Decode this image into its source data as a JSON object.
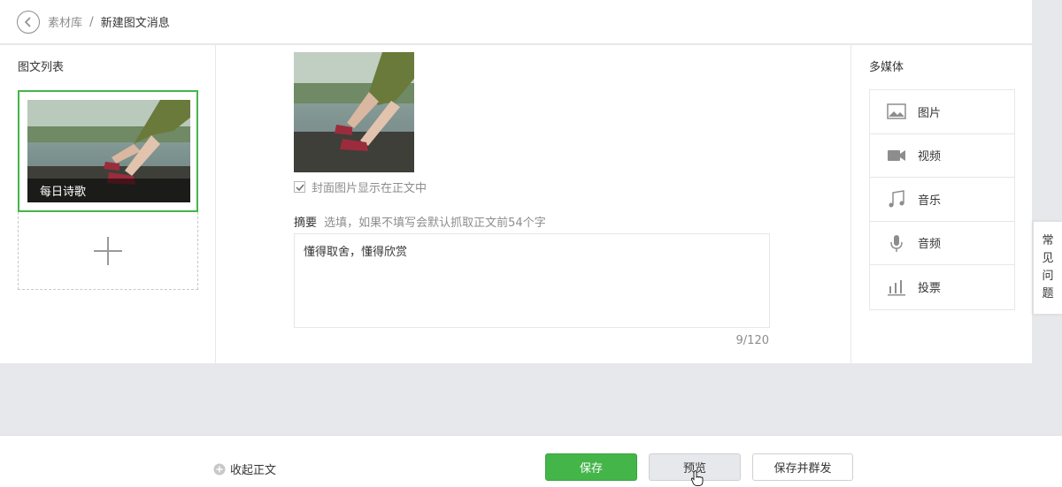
{
  "breadcrumb": {
    "parent": "素材库",
    "separator": "/",
    "current": "新建图文消息"
  },
  "left_panel": {
    "title": "图文列表",
    "articles": [
      {
        "caption": "每日诗歌"
      }
    ],
    "add_icon": "plus-icon"
  },
  "editor": {
    "cover_checkbox": {
      "checked": true,
      "label": "封面图片显示在正文中"
    },
    "abstract": {
      "label": "摘要",
      "hint": "选填，如果不填写会默认抓取正文前54个字",
      "value": "懂得取舍，懂得欣赏",
      "counter": "9/120"
    }
  },
  "media_panel": {
    "title": "多媒体",
    "items": [
      {
        "label": "图片",
        "icon": "image-icon"
      },
      {
        "label": "视频",
        "icon": "video-icon"
      },
      {
        "label": "音乐",
        "icon": "music-icon"
      },
      {
        "label": "音频",
        "icon": "microphone-icon"
      },
      {
        "label": "投票",
        "icon": "poll-icon"
      }
    ]
  },
  "faq_tab": {
    "chars": [
      "常",
      "见",
      "问",
      "题"
    ]
  },
  "bottom_bar": {
    "collapse_label": "收起正文",
    "save_label": "保存",
    "preview_label": "预览",
    "publish_label": "保存并群发"
  },
  "colors": {
    "accent": "#44b549",
    "page_bg": "#e7e8eb",
    "text": "#353535",
    "muted": "#8d8d8d"
  }
}
